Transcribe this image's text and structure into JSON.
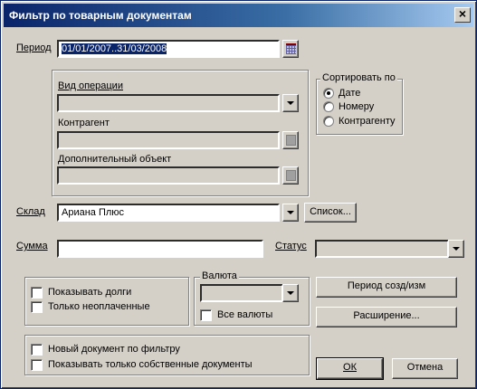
{
  "window": {
    "title": "Фильтр по товарным документам",
    "close_glyph": "×"
  },
  "period": {
    "label": "Период",
    "value": "01/01/2007..31/03/2008"
  },
  "operation": {
    "label": "Вид операции",
    "value": ""
  },
  "counterparty": {
    "label": "Контрагент",
    "value": ""
  },
  "extra_object": {
    "label": "Дополнительный объект",
    "value": ""
  },
  "sort": {
    "title": "Сортировать по",
    "options": [
      {
        "label": "Дате",
        "selected": true
      },
      {
        "label": "Номеру",
        "selected": false
      },
      {
        "label": "Контрагенту",
        "selected": false
      }
    ]
  },
  "warehouse": {
    "label": "Склад",
    "value": "Ариана Плюс",
    "list_button": "Список..."
  },
  "amount": {
    "label": "Сумма",
    "value": ""
  },
  "status": {
    "label": "Статус",
    "value": ""
  },
  "debts": {
    "show_debts": "Показывать долги",
    "only_unpaid": "Только неоплаченные"
  },
  "currency": {
    "title": "Валюта",
    "value": "",
    "all_currencies": "Все валюты"
  },
  "buttons": {
    "period_edit": "Период созд/изм",
    "extension": "Расширение...",
    "ok": "ОК",
    "cancel": "Отмена"
  },
  "bottom": {
    "new_doc_by_filter": "Новый документ по фильтру",
    "only_own_docs": "Показывать только собственные документы"
  },
  "colors": {
    "title_bar": "#0a246a",
    "face": "#d4d0c8",
    "selection": "#0a246a"
  }
}
